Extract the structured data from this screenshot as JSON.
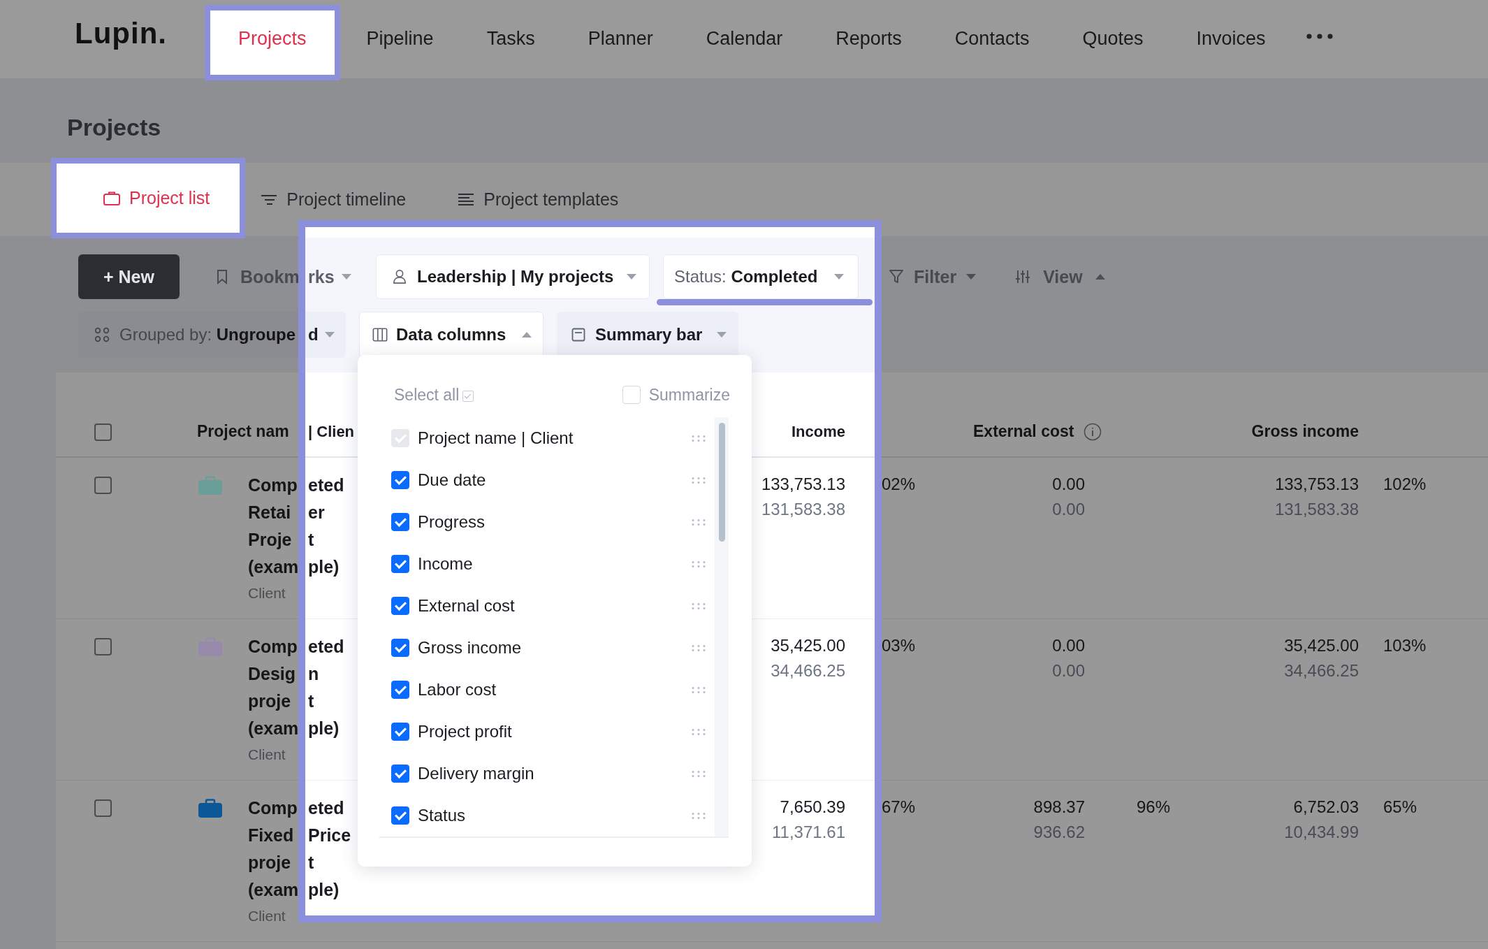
{
  "nav": {
    "logo": "Lupin.",
    "items": [
      {
        "label": "Projects",
        "selected": true
      },
      {
        "label": "Pipeline",
        "selected": false
      },
      {
        "label": "Tasks",
        "selected": false
      },
      {
        "label": "Planner",
        "selected": false
      },
      {
        "label": "Calendar",
        "selected": false
      },
      {
        "label": "Reports",
        "selected": false
      },
      {
        "label": "Contacts",
        "selected": false
      },
      {
        "label": "Quotes",
        "selected": false
      },
      {
        "label": "Invoices",
        "selected": false
      }
    ]
  },
  "page_title": "Projects",
  "view_tabs": [
    {
      "kind": "list",
      "label": "Project list",
      "selected": true
    },
    {
      "kind": "timeline",
      "label": "Project timeline",
      "selected": false
    },
    {
      "kind": "templates",
      "label": "Project templates",
      "selected": false
    }
  ],
  "toolbar": {
    "new_button": "+ New",
    "bookmarks": {
      "label_left": "Bookm",
      "label_right": "rks",
      "expanded": false
    },
    "people_filter": {
      "label": "Leadership | My projects",
      "expanded": false
    },
    "status_filter": {
      "label": "Status: **Completed**",
      "expanded": false
    },
    "filter": {
      "label": "Filter",
      "expanded": false
    },
    "view": {
      "label": "View",
      "expanded": true
    },
    "grouped_by": {
      "label_left": "Grouped by: **Ungroupe**",
      "label_right": "d",
      "expanded": false
    },
    "data_columns": {
      "label": "Data columns",
      "expanded": true
    },
    "summary_bar": {
      "label": "Summary bar",
      "expanded": false
    }
  },
  "data_columns_menu": {
    "select_all": {
      "label": "Select all",
      "checked": true
    },
    "summarize": {
      "label": "Summarize",
      "checked": false
    },
    "columns": [
      {
        "label": "Project name | Client",
        "checked": true,
        "disabled": true
      },
      {
        "label": "Due date",
        "checked": true,
        "disabled": false
      },
      {
        "label": "Progress",
        "checked": true,
        "disabled": false
      },
      {
        "label": "Income",
        "checked": true,
        "disabled": false
      },
      {
        "label": "External cost",
        "checked": true,
        "disabled": false
      },
      {
        "label": "Gross income",
        "checked": true,
        "disabled": false
      },
      {
        "label": "Labor cost",
        "checked": true,
        "disabled": false
      },
      {
        "label": "Project profit",
        "checked": true,
        "disabled": false
      },
      {
        "label": "Delivery margin",
        "checked": true,
        "disabled": false
      },
      {
        "label": "Status",
        "checked": true,
        "disabled": false
      }
    ]
  },
  "table": {
    "header": {
      "checked": false,
      "name_left": "Project nam",
      "name_right": "| Clien",
      "income": "Income",
      "external_cost": "External cost",
      "gross_income": "Gross income"
    },
    "rows": [
      {
        "checked": false,
        "color": "#6b9e99",
        "name_left": [
          "Comp",
          "Retai",
          "Proje",
          "(exam"
        ],
        "name_right": [
          "eted",
          "er",
          "t",
          "ple)"
        ],
        "client": "Client",
        "income": [
          "133,753.13",
          "131,583.38"
        ],
        "income_pct": "02%",
        "external": [
          "0.00",
          "0.00"
        ],
        "gross": [
          "133,753.13",
          "131,583.38"
        ],
        "gross_pct": "102%"
      },
      {
        "checked": false,
        "color": "#988aab",
        "name_left": [
          "Comp",
          "Desig",
          "proje",
          "(exam"
        ],
        "name_right": [
          "eted",
          "n",
          "t",
          "ple)"
        ],
        "client": "Client",
        "income": [
          "35,425.00",
          "34,466.25"
        ],
        "income_pct": "03%",
        "external": [
          "0.00",
          "0.00"
        ],
        "gross": [
          "35,425.00",
          "34,466.25"
        ],
        "gross_pct": "103%"
      },
      {
        "checked": false,
        "color": "#0b5797",
        "name_left": [
          "Comp",
          "Fixed",
          "proje",
          "(exam"
        ],
        "name_right": [
          "eted",
          "Price",
          "t",
          "ple)"
        ],
        "client": "Client",
        "income": [
          "7,650.39",
          "11,371.61"
        ],
        "income_pct": "67%",
        "external": [
          "898.37",
          "936.62"
        ],
        "external_pct": "96%",
        "gross": [
          "6,752.03",
          "10,434.99"
        ],
        "gross_pct": "65%"
      }
    ]
  }
}
